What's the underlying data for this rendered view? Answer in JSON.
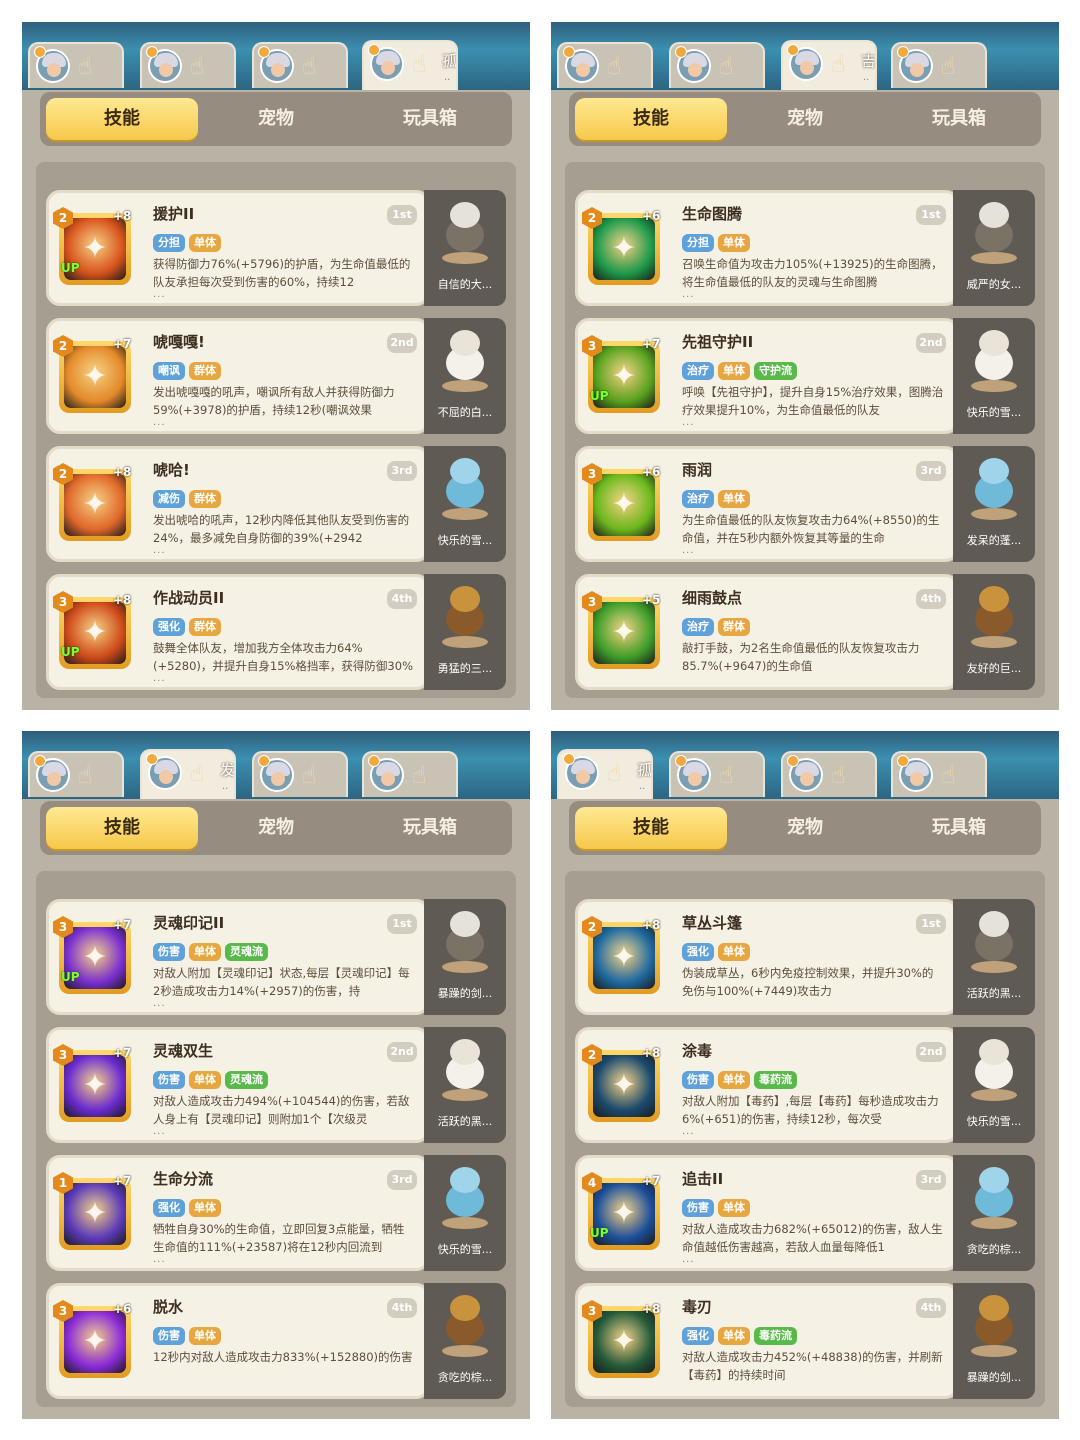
{
  "panels": [
    {
      "char_tabs": [
        {
          "name": "",
          "dots": ""
        },
        {
          "name": "",
          "dots": ""
        },
        {
          "name": "",
          "dots": ""
        },
        {
          "name": "孤影足.",
          "dots": ".."
        }
      ],
      "active_char": 3,
      "tabs": [
        "技能",
        "宠物",
        "玩具箱"
      ],
      "skills": [
        {
          "name": "援护II",
          "order": "1st",
          "level": "2",
          "plus": "+8",
          "up": "UP",
          "tags": [
            {
              "t": "分担",
              "c": "blue"
            },
            {
              "t": "单体",
              "c": "orange"
            }
          ],
          "desc": "获得防御力76%(+5796)的护盾，为生命值最低的队友承担每次受到伤害的60%，持续12",
          "more": "...",
          "pet": "自信的大...",
          "iconColor": "#d8531c"
        },
        {
          "name": "唬嘎嘎!",
          "order": "2nd",
          "level": "2",
          "plus": "+7",
          "up": "",
          "tags": [
            {
              "t": "嘲讽",
              "c": "blue"
            },
            {
              "t": "群体",
              "c": "orange"
            }
          ],
          "desc": "发出唬嘎嘎的吼声，嘲讽所有敌人并获得防御力59%(+3978)的护盾，持续12秒(嘲讽效果",
          "more": "...",
          "pet": "不屈的白...",
          "iconColor": "#e48a2a"
        },
        {
          "name": "唬哈!",
          "order": "3rd",
          "level": "2",
          "plus": "+8",
          "up": "",
          "tags": [
            {
              "t": "减伤",
              "c": "blue"
            },
            {
              "t": "群体",
              "c": "orange"
            }
          ],
          "desc": "发出唬哈的吼声，12秒内降低其他队友受到伤害的24%，最多减免自身防御的39%(+2942",
          "more": "...",
          "pet": "快乐的雪...",
          "iconColor": "#e0682a"
        },
        {
          "name": "作战动员II",
          "order": "4th",
          "level": "3",
          "plus": "+8",
          "up": "UP",
          "tags": [
            {
              "t": "强化",
              "c": "blue"
            },
            {
              "t": "群体",
              "c": "orange"
            }
          ],
          "desc": "鼓舞全体队友，增加我方全体攻击力64%(+5280)，并提升自身15%格挡率，获得防御30%",
          "more": "...",
          "pet": "勇猛的三...",
          "iconColor": "#cf4a1a"
        }
      ]
    },
    {
      "char_tabs": [
        {
          "name": "",
          "dots": ""
        },
        {
          "name": "",
          "dots": ""
        },
        {
          "name": "吉星高.",
          "dots": ".."
        },
        {
          "name": "",
          "dots": ""
        }
      ],
      "active_char": 2,
      "tabs": [
        "技能",
        "宠物",
        "玩具箱"
      ],
      "skills": [
        {
          "name": "生命图腾",
          "order": "1st",
          "level": "2",
          "plus": "+6",
          "up": "",
          "tags": [
            {
              "t": "分担",
              "c": "blue"
            },
            {
              "t": "单体",
              "c": "orange"
            }
          ],
          "desc": "召唤生命值为攻击力105%(+13925)的生命图腾，将生命值最低的队友的灵魂与生命图腾",
          "more": "...",
          "pet": "威严的女...",
          "iconColor": "#1e9a4a"
        },
        {
          "name": "先祖守护II",
          "order": "2nd",
          "level": "3",
          "plus": "+7",
          "up": "UP",
          "tags": [
            {
              "t": "治疗",
              "c": "blue"
            },
            {
              "t": "单体",
              "c": "orange"
            },
            {
              "t": "守护流",
              "c": "green"
            }
          ],
          "desc": "呼唤【先祖守护】，提升自身15%治疗效果，图腾治疗效果提升10%，为生命值最低的队友",
          "more": "...",
          "pet": "快乐的雪...",
          "iconColor": "#5aa21e"
        },
        {
          "name": "雨润",
          "order": "3rd",
          "level": "3",
          "plus": "+6",
          "up": "",
          "tags": [
            {
              "t": "治疗",
              "c": "blue"
            },
            {
              "t": "单体",
              "c": "orange"
            }
          ],
          "desc": "为生命值最低的队友恢复攻击力64%(+8550)的生命值，并在5秒内额外恢复其等量的生命",
          "more": "...",
          "pet": "发呆的蓬...",
          "iconColor": "#6cb81c"
        },
        {
          "name": "细雨鼓点",
          "order": "4th",
          "level": "3",
          "plus": "+5",
          "up": "",
          "tags": [
            {
              "t": "治疗",
              "c": "blue"
            },
            {
              "t": "群体",
              "c": "orange"
            }
          ],
          "desc": "敲打手鼓，为2名生命值最低的队友恢复攻击力85.7%(+9647)的生命值",
          "more": "",
          "pet": "友好的巨...",
          "iconColor": "#3f9e2a"
        }
      ]
    },
    {
      "char_tabs": [
        {
          "name": "",
          "dots": ""
        },
        {
          "name": "发财发.",
          "dots": ".."
        },
        {
          "name": "",
          "dots": ""
        },
        {
          "name": "",
          "dots": ""
        }
      ],
      "active_char": 1,
      "tabs": [
        "技能",
        "宠物",
        "玩具箱"
      ],
      "skills": [
        {
          "name": "灵魂印记II",
          "order": "1st",
          "level": "3",
          "plus": "+7",
          "up": "UP",
          "tags": [
            {
              "t": "伤害",
              "c": "blue"
            },
            {
              "t": "单体",
              "c": "orange"
            },
            {
              "t": "灵魂流",
              "c": "green"
            }
          ],
          "desc": "对敌人附加【灵魂印记】状态,每层【灵魂印记】每2秒造成攻击力14%(+2957)的伤害，持",
          "more": "...",
          "pet": "暴躁的剑...",
          "iconColor": "#7a2fd0"
        },
        {
          "name": "灵魂双生",
          "order": "2nd",
          "level": "3",
          "plus": "+7",
          "up": "",
          "tags": [
            {
              "t": "伤害",
              "c": "blue"
            },
            {
              "t": "单体",
              "c": "orange"
            },
            {
              "t": "灵魂流",
              "c": "green"
            }
          ],
          "desc": "对敌人造成攻击力494%(+104544)的伤害，若敌人身上有【灵魂印记】则附加1个【次级灵",
          "more": "...",
          "pet": "活跃的黑...",
          "iconColor": "#6a2ad0"
        },
        {
          "name": "生命分流",
          "order": "3rd",
          "level": "1",
          "plus": "+7",
          "up": "",
          "tags": [
            {
              "t": "强化",
              "c": "blue"
            },
            {
              "t": "单体",
              "c": "orange"
            }
          ],
          "desc": "牺牲自身30%的生命值，立即回复3点能量，牺牲生命值的111%(+23587)将在12秒内回流到",
          "more": "...",
          "pet": "快乐的雪...",
          "iconColor": "#5a3ab8"
        },
        {
          "name": "脱水",
          "order": "4th",
          "level": "3",
          "plus": "+6",
          "up": "",
          "tags": [
            {
              "t": "伤害",
              "c": "blue"
            },
            {
              "t": "单体",
              "c": "orange"
            }
          ],
          "desc": "12秒内对敌人造成攻击力833%(+152880)的伤害",
          "more": "",
          "pet": "贪吃的棕...",
          "iconColor": "#8a2ad8"
        }
      ]
    },
    {
      "char_tabs": [
        {
          "name": "孤独终.",
          "dots": ".."
        },
        {
          "name": "",
          "dots": ""
        },
        {
          "name": "",
          "dots": ""
        },
        {
          "name": "",
          "dots": ""
        }
      ],
      "active_char": 0,
      "tabs": [
        "技能",
        "宠物",
        "玩具箱"
      ],
      "skills": [
        {
          "name": "草丛斗篷",
          "order": "1st",
          "level": "2",
          "plus": "+8",
          "up": "",
          "tags": [
            {
              "t": "强化",
              "c": "blue"
            },
            {
              "t": "单体",
              "c": "orange"
            }
          ],
          "desc": "伪装成草丛，6秒内免疫控制效果，并提升30%的免伤与100%(+7449)攻击力",
          "more": "",
          "pet": "活跃的黑...",
          "iconColor": "#1f6aa0"
        },
        {
          "name": "涂毒",
          "order": "2nd",
          "level": "2",
          "plus": "+8",
          "up": "",
          "tags": [
            {
              "t": "伤害",
              "c": "blue"
            },
            {
              "t": "单体",
              "c": "orange"
            },
            {
              "t": "毒药流",
              "c": "green"
            }
          ],
          "desc": "对敌人附加【毒药】,每层【毒药】每秒造成攻击力6%(+651)的伤害，持续12秒，每次受",
          "more": "...",
          "pet": "快乐的雪...",
          "iconColor": "#1b4a6e"
        },
        {
          "name": "追击II",
          "order": "3rd",
          "level": "4",
          "plus": "+7",
          "up": "UP",
          "tags": [
            {
              "t": "伤害",
              "c": "blue"
            },
            {
              "t": "单体",
              "c": "orange"
            }
          ],
          "desc": "对敌人造成攻击力682%(+65012)的伤害，敌人生命值越低伤害越高，若敌人血量每降低1",
          "more": "...",
          "pet": "贪吃的棕...",
          "iconColor": "#1c4f9a"
        },
        {
          "name": "毒刃",
          "order": "4th",
          "level": "3",
          "plus": "+8",
          "up": "",
          "tags": [
            {
              "t": "强化",
              "c": "blue"
            },
            {
              "t": "单体",
              "c": "orange"
            },
            {
              "t": "毒药流",
              "c": "green"
            }
          ],
          "desc": "对敌人造成攻击力452%(+48838)的伤害，并刷新【毒药】的持续时间",
          "more": "",
          "pet": "暴躁的剑...",
          "iconColor": "#245a3a"
        }
      ]
    }
  ]
}
